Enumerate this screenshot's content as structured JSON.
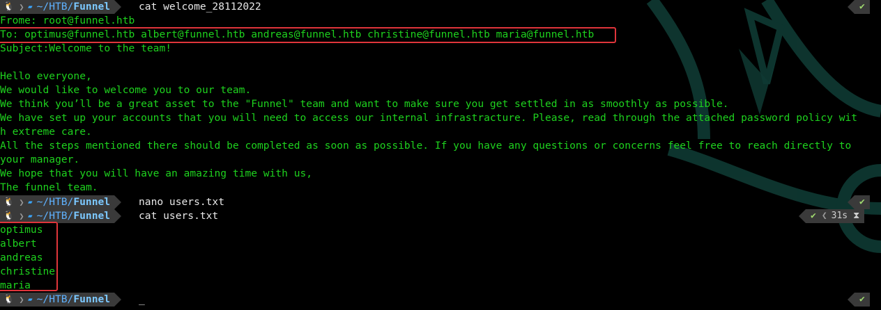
{
  "prompt": {
    "os_icon": "linux-tux-icon",
    "path_prefix": "~/HTB/",
    "path_current": "Funnel"
  },
  "blocks": [
    {
      "command": "cat welcome_28112022",
      "status": "✔",
      "output": [
        "Frome: root@funnel.htb",
        "To: optimus@funnel.htb albert@funnel.htb andreas@funnel.htb christine@funnel.htb maria@funnel.htb",
        "Subject:Welcome to the team!",
        "",
        "Hello everyone,",
        "We would like to welcome you to our team.",
        "We think you’ll be a great asset to the \"Funnel\" team and want to make sure you get settled in as smoothly as possible.",
        "We have set up your accounts that you will need to access our internal infrastracture. Please, read through the attached password policy wit",
        "h extreme care.",
        "All the steps mentioned there should be completed as soon as possible. If you have any questions or concerns feel free to reach directly to",
        "your manager.",
        "We hope that you will have an amazing time with us,",
        "The funnel team."
      ]
    },
    {
      "command": "nano users.txt",
      "status": "✔",
      "output": []
    },
    {
      "command": "cat users.txt",
      "status": "✔",
      "duration": "31s",
      "output": [
        "optimus",
        "albert",
        "andreas",
        "christine",
        "maria"
      ]
    },
    {
      "command": "_",
      "status": "✔",
      "output": []
    }
  ],
  "colors": {
    "output_green": "#1ed21e",
    "path_blue": "#3aa7ff",
    "segment_bg": "#3a3a3a",
    "highlight_red": "#e0353b",
    "check_green": "#9fd86f"
  }
}
